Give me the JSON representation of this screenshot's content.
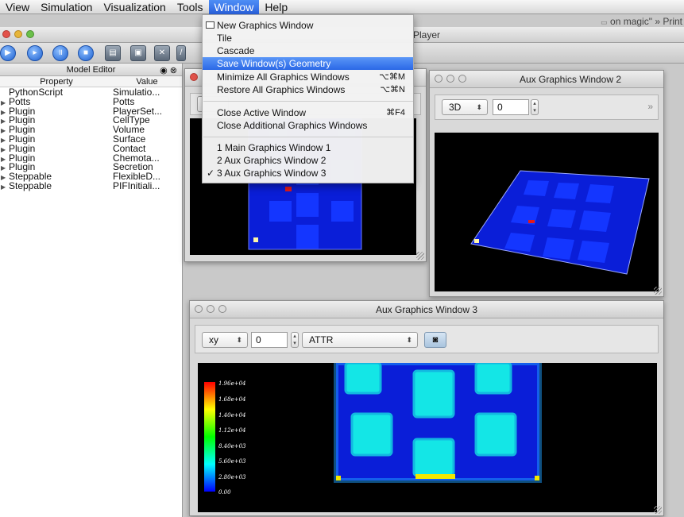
{
  "menubar": {
    "items": [
      "View",
      "Simulation",
      "Visualization",
      "Tools",
      "Window",
      "Help"
    ],
    "active": "Window",
    "right_text": "on magic\" » Print"
  },
  "player": {
    "title": "Player"
  },
  "model_editor": {
    "title": "Model Editor",
    "col_property": "Property",
    "col_value": "Value",
    "rows": [
      {
        "property": "PythonScript",
        "value": "Simulatio...",
        "expandable": false
      },
      {
        "property": "Potts",
        "value": "Potts",
        "expandable": true
      },
      {
        "property": "Plugin",
        "value": "PlayerSet...",
        "expandable": true
      },
      {
        "property": "Plugin",
        "value": "CellType",
        "expandable": true
      },
      {
        "property": "Plugin",
        "value": "Volume",
        "expandable": true
      },
      {
        "property": "Plugin",
        "value": "Surface",
        "expandable": true
      },
      {
        "property": "Plugin",
        "value": "Contact",
        "expandable": true
      },
      {
        "property": "Plugin",
        "value": "Chemota...",
        "expandable": true
      },
      {
        "property": "Plugin",
        "value": "Secretion",
        "expandable": true
      },
      {
        "property": "Steppable",
        "value": "FlexibleD...",
        "expandable": true
      },
      {
        "property": "Steppable",
        "value": "PIFInitiali...",
        "expandable": true
      }
    ]
  },
  "window_menu": {
    "items": [
      {
        "label": "New Graphics Window",
        "shortcut": "",
        "icon": "window-icon"
      },
      {
        "label": "Tile",
        "shortcut": ""
      },
      {
        "label": "Cascade",
        "shortcut": ""
      },
      {
        "label": "Save Window(s) Geometry",
        "shortcut": "",
        "highlighted": true
      },
      {
        "label": "Minimize All Graphics Windows",
        "shortcut": "⌥⌘M"
      },
      {
        "label": "Restore All Graphics Windows",
        "shortcut": "⌥⌘N"
      },
      {
        "label": "Close Active Window",
        "shortcut": "⌘F4"
      },
      {
        "label": "Close Additional Graphics Windows",
        "shortcut": ""
      },
      {
        "label": "1 Main Graphics Window 1",
        "shortcut": ""
      },
      {
        "label": "2 Aux Graphics Window 2",
        "shortcut": ""
      },
      {
        "label": "3 Aux Graphics Window 3",
        "shortcut": "",
        "checked": true
      }
    ],
    "check_mark": "✓"
  },
  "aux2": {
    "title": "Aux Graphics Window 2",
    "projection": "3D",
    "slice": "0",
    "overflow": "»"
  },
  "aux3": {
    "title": "Aux Graphics Window 3",
    "plane": "xy",
    "slice": "0",
    "field": "ATTR",
    "colorbar_labels": [
      "1.96e+04",
      "1.68e+04",
      "1.40e+04",
      "1.12e+04",
      "8.40e+03",
      "5.60e+03",
      "2.80e+03",
      "0.00"
    ]
  },
  "colors": {
    "menu_highlight": "#2b68e6",
    "cell_blue": "#1436ff",
    "field_cyan": "#14e6e6",
    "medium_blue": "#0a1ed8"
  }
}
